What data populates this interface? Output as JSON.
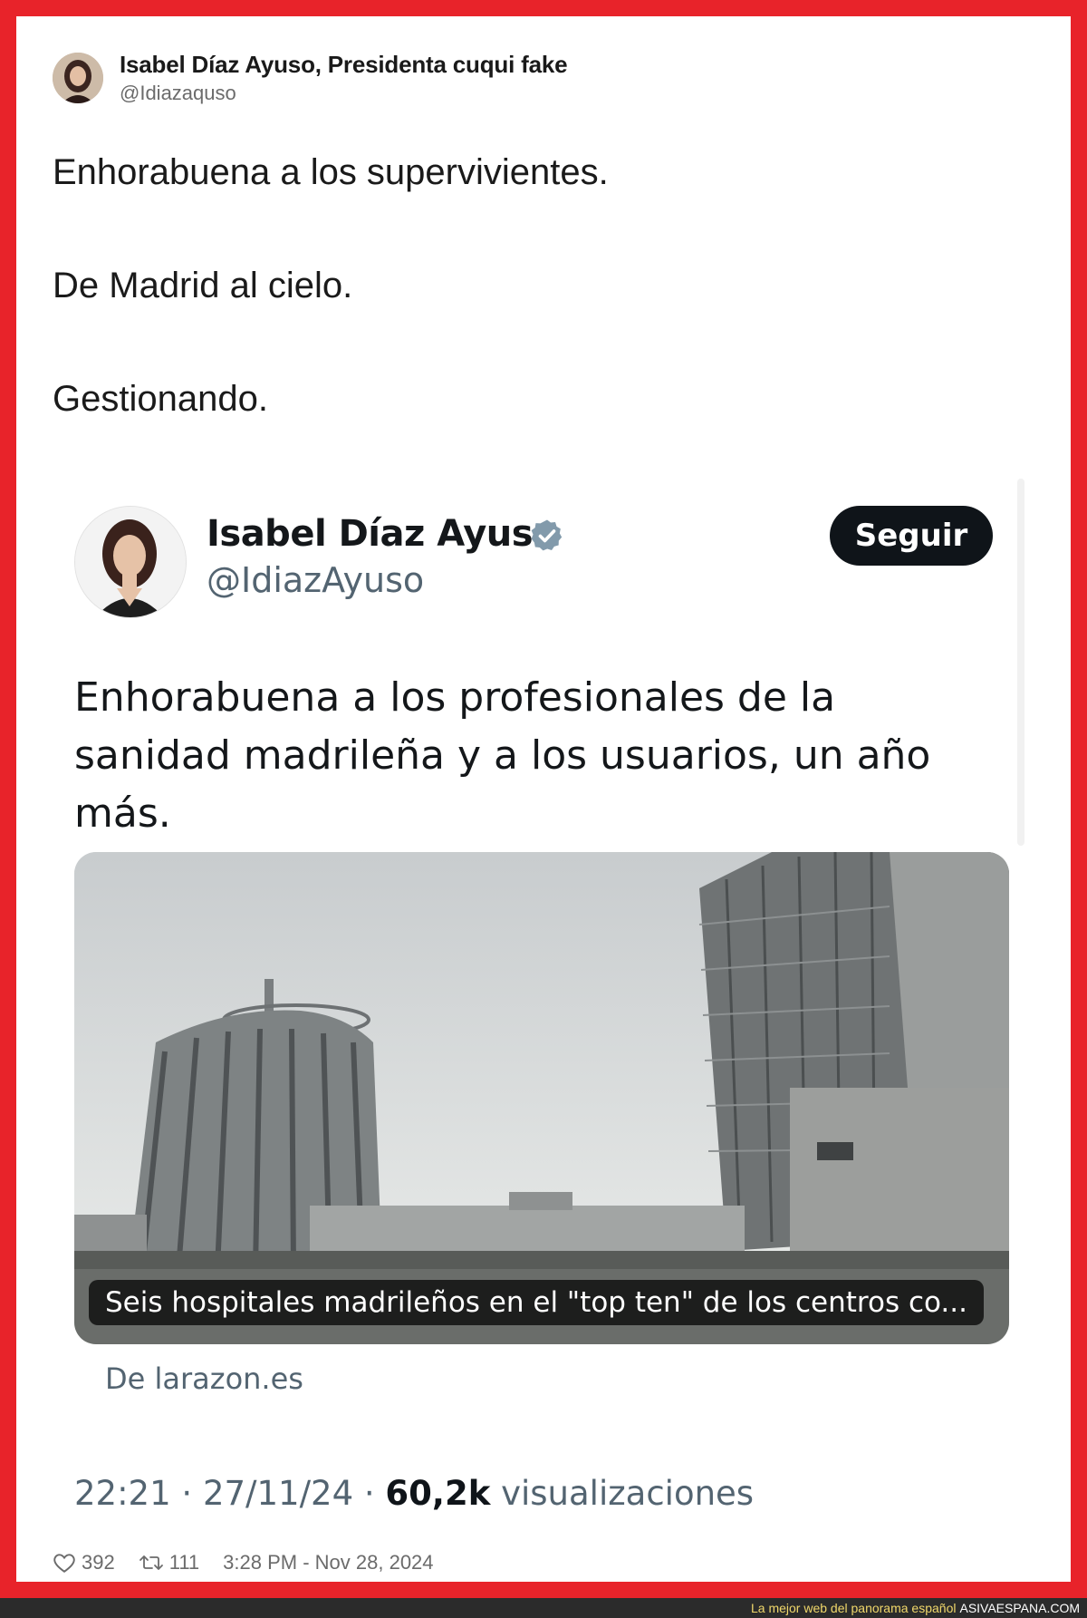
{
  "outer_post": {
    "display_name": "Isabel Díaz Ayuso, Presidenta cuqui fake",
    "handle": "@Idiazaquso",
    "lines": [
      "Enhorabuena a los supervivientes.",
      "De Madrid al cielo.",
      "Gestionando."
    ],
    "likes": "392",
    "retweets": "111",
    "timestamp": "3:28 PM - Nov 28, 2024"
  },
  "quoted_post": {
    "display_name": "Isabel Díaz Ayuso",
    "handle": "@IdiazAyuso",
    "follow_label": "Seguir",
    "text": "Enhorabuena a los profesionales de la sanidad madrileña y a los usuarios, un año más.",
    "link_card": {
      "caption": "Seis hospitales madrileños en el \"top ten\" de los centros co...",
      "source": "De larazon.es"
    },
    "time": "22:21",
    "date": "27/11/24",
    "views_count": "60,2k",
    "views_label": "visualizaciones"
  },
  "footer": {
    "tagline": "La mejor web del panorama español",
    "site": "ASIVAESPANA.COM"
  },
  "colors": {
    "frame": "#e8232a",
    "verified": "#829aab",
    "follow_button": "#0f1419"
  },
  "icons": [
    "heart-icon",
    "retweet-icon",
    "verified-badge-icon"
  ]
}
